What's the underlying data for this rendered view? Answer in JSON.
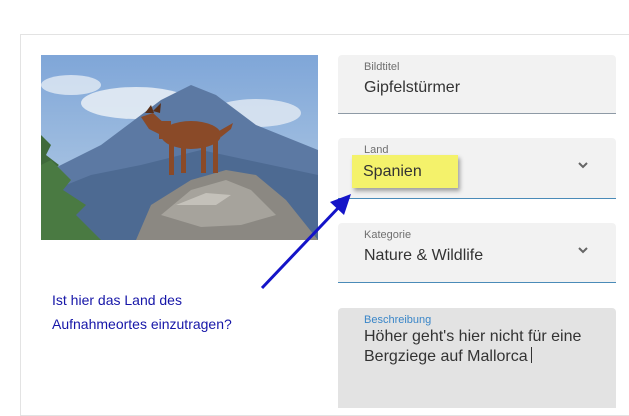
{
  "form": {
    "title_field": {
      "label": "Bildtitel",
      "value": "Gipfelstürmer"
    },
    "country_field": {
      "label": "Land",
      "value": "Spanien",
      "icon": "chevron-down-icon"
    },
    "category_field": {
      "label": "Kategorie",
      "value": "Nature & Wildlife",
      "icon": "chevron-down-icon"
    },
    "description_field": {
      "label": "Beschreibung",
      "value": "Höher geht's hier nicht für eine Bergziege auf Mallorca"
    }
  },
  "annotation": {
    "question_line1": "Ist hier das Land des",
    "question_line2": "Aufnahmeortes einzutragen?",
    "highlight_color": "#f4f26b",
    "arrow_color": "#1414c8"
  },
  "photo": {
    "subject": "goat-on-rock-photo"
  }
}
